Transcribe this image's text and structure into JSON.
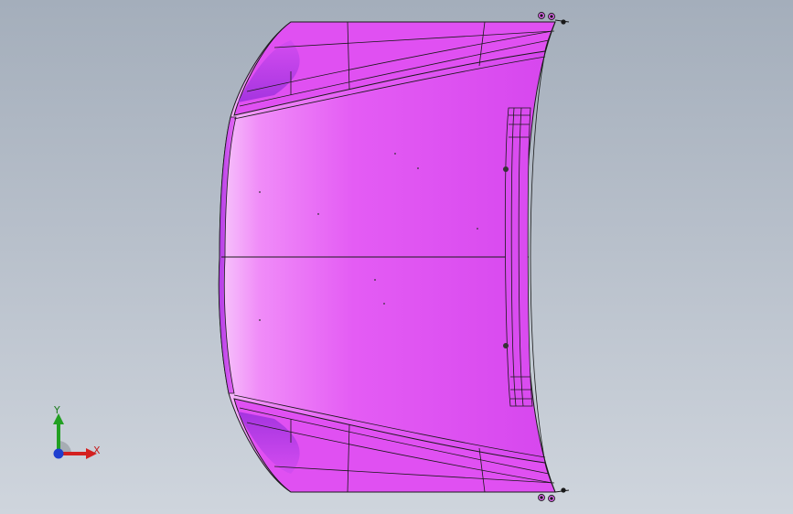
{
  "viewport": {
    "model_fill": "#e45cf4",
    "edge_color": "#1a1a1a"
  },
  "triad": {
    "x_label": "X",
    "y_label": "Y",
    "x_color": "#d42020",
    "y_color": "#22a022",
    "z_color": "#1f3fd0"
  }
}
